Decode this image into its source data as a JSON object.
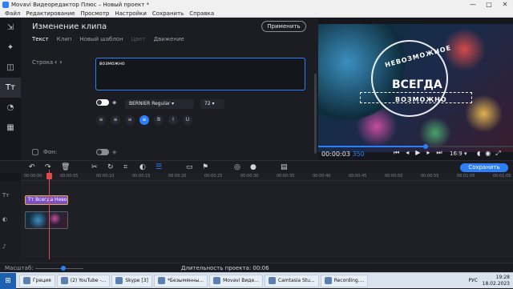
{
  "window": {
    "title": "Movavi Видеоредактор Плюс – Новый проект *",
    "controls": [
      "—",
      "□",
      "✕"
    ]
  },
  "menu": [
    "Файл",
    "Редактирование",
    "Просмотр",
    "Настройки",
    "Сохранить",
    "Справка"
  ],
  "sidebar_tools": [
    "import-icon",
    "magic-wand-icon",
    "transitions-icon",
    "titles-icon",
    "filters-icon",
    "more-tools-icon"
  ],
  "panel": {
    "title": "Изменение клипа",
    "apply": "Применить",
    "tabs": [
      "Текст",
      "Клип",
      "Новый шаблон",
      "Цвет",
      "Движение"
    ],
    "row_label": "Строка",
    "text_value": "возможно",
    "font": "BERNIER Regular",
    "font_size": "72",
    "background_label": "Фон:"
  },
  "preview": {
    "overlay_top": "НЕВОЗМОЖНОЕ",
    "overlay_main": "ВСЕГДА",
    "overlay_bottom": "ВОЗМОЖНО",
    "time_current": "00:00:03",
    "time_frames": "350",
    "ratio": "16:9",
    "progress": 0.55
  },
  "timeline": {
    "export": "Сохранить",
    "ruler": [
      "00:00:00",
      "00:00:05",
      "00:00:10",
      "00:00:15",
      "00:00:20",
      "00:00:25",
      "00:00:30",
      "00:00:35",
      "00:00:40",
      "00:00:45",
      "00:00:50",
      "00:00:55",
      "00:01:00",
      "00:01:05"
    ],
    "title_clip": "Тт Всегда Нево",
    "scale_label": "Масштаб:",
    "duration": "Длительность проекта:  00:06"
  },
  "taskbar": {
    "items": [
      "Греция",
      "(2) YouTube -...",
      "Skype [3]",
      "*Безымянны...",
      "Movavi Виде...",
      "Camtasia Stu...",
      "Recording...."
    ],
    "lang": "РУС",
    "time": "19:28",
    "date": "18.02.2023"
  }
}
